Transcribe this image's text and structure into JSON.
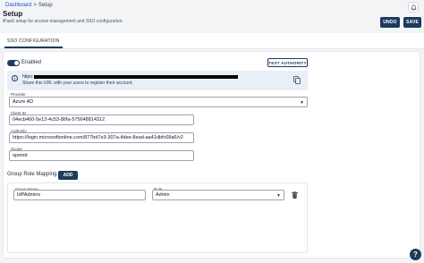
{
  "breadcrumb": {
    "home": "Dashboard",
    "separator": ">",
    "current": "Setup"
  },
  "header": {
    "title": "Setup",
    "subtitle": "iPaaS setup for access management and SSO configuration.",
    "undo_label": "UNDO",
    "save_label": "SAVE",
    "bell_icon": "bell-icon"
  },
  "tabs": [
    {
      "label": "SSO CONFIGURATION",
      "active": true
    }
  ],
  "sso": {
    "enabled_label": "Enabled",
    "enabled": true,
    "test_authority_label": "TEST AUTHORITY",
    "url_prefix": "https:",
    "share_text": "Share this URL with your users to register their account.",
    "provider_label": "Provider",
    "provider_value": "Azure AD",
    "client_id_label": "Client ID",
    "client_id_value": "04ecb460-5e13-4c53-86fa-575648814312",
    "authority_label": "Authority",
    "authority_value": "https://login.microsoftonline.com/877bd7e3-307a-4dee-8ead-aa41dbfc68a6/v2",
    "scope_label": "Scope",
    "scope_value": "openid"
  },
  "group_mapping": {
    "title": "Group Role Mapping",
    "add_label": "ADD",
    "rows": [
      {
        "group_name_label": "Group Name",
        "group_name_value": "IdPAdmins",
        "role_label": "Role",
        "role_value": "Admin"
      }
    ]
  },
  "help_label": "?",
  "colors": {
    "primary": "#1e3a5f",
    "info_bg": "#e8eff7",
    "page_bg": "#f3f4f6"
  }
}
